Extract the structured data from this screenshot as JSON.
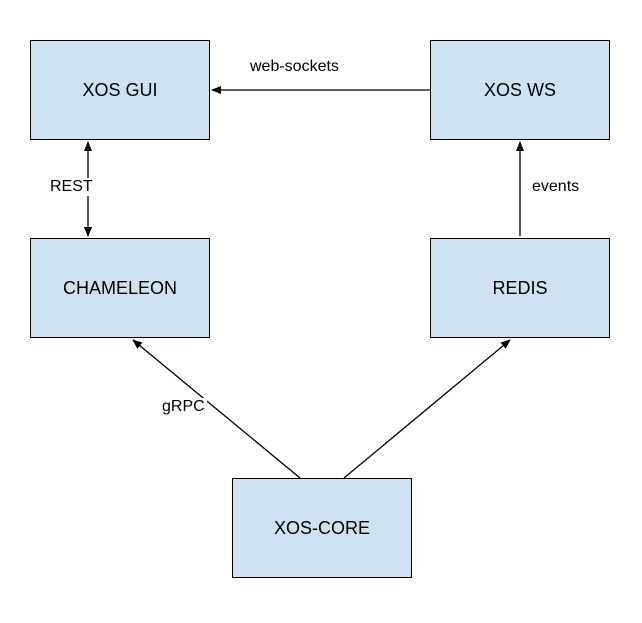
{
  "nodes": {
    "xos_gui": {
      "label": "XOS GUI"
    },
    "xos_ws": {
      "label": "XOS WS"
    },
    "chameleon": {
      "label": "CHAMELEON"
    },
    "redis": {
      "label": "REDIS"
    },
    "xos_core": {
      "label": "XOS-CORE"
    }
  },
  "edges": {
    "rest": {
      "label": "REST"
    },
    "web_sockets": {
      "label": "web-sockets"
    },
    "events": {
      "label": "events"
    },
    "grpc": {
      "label": "gRPC"
    }
  },
  "chart_data": {
    "type": "diagram",
    "title": "",
    "nodes": [
      {
        "id": "xos_gui",
        "label": "XOS GUI"
      },
      {
        "id": "xos_ws",
        "label": "XOS WS"
      },
      {
        "id": "chameleon",
        "label": "CHAMELEON"
      },
      {
        "id": "redis",
        "label": "REDIS"
      },
      {
        "id": "xos_core",
        "label": "XOS-CORE"
      }
    ],
    "edges": [
      {
        "from": "xos_gui",
        "to": "chameleon",
        "label": "REST",
        "direction": "bidirectional"
      },
      {
        "from": "xos_ws",
        "to": "xos_gui",
        "label": "web-sockets",
        "direction": "unidirectional"
      },
      {
        "from": "redis",
        "to": "xos_ws",
        "label": "events",
        "direction": "unidirectional"
      },
      {
        "from": "xos_core",
        "to": "chameleon",
        "label": "gRPC",
        "direction": "unidirectional"
      },
      {
        "from": "xos_core",
        "to": "redis",
        "label": "gRPC",
        "direction": "unidirectional"
      }
    ]
  }
}
